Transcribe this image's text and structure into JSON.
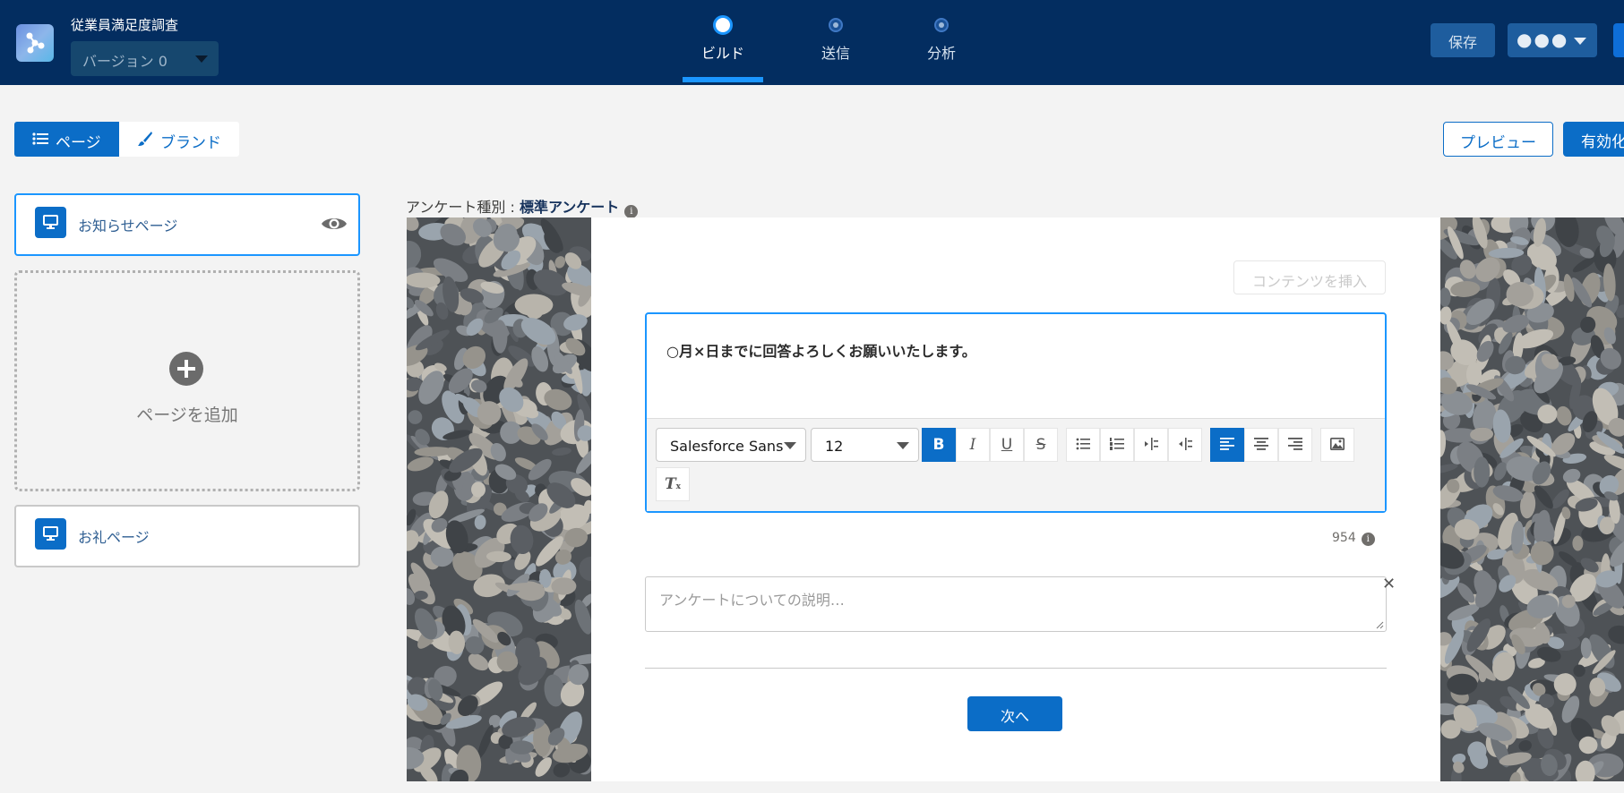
{
  "header": {
    "survey_title": "従業員満足度調査",
    "version_label": "バージョン 0",
    "steps": [
      {
        "label": "ビルド",
        "active": true
      },
      {
        "label": "送信",
        "active": false
      },
      {
        "label": "分析",
        "active": false
      }
    ],
    "save_label": "保存",
    "more_label": "●●●"
  },
  "toolbar": {
    "pages_tab": "ページ",
    "brand_tab": "ブランド",
    "preview_label": "プレビュー",
    "activate_label": "有効化"
  },
  "sidebar": {
    "pages": [
      {
        "name": "お知らせページ"
      },
      {
        "name": "お礼ページ"
      }
    ],
    "add_page_label": "ページを追加"
  },
  "canvas": {
    "survey_type_label": "アンケート種別 : ",
    "survey_type_value": "標準アンケート",
    "insert_content_label": "コンテンツを挿入",
    "welcome_text": "○月×日までに回答よろしくお願いいたします。",
    "font_family": "Salesforce Sans",
    "font_size": "12",
    "char_count": "954",
    "description_placeholder": "アンケートについての説明…",
    "next_button": "次へ"
  },
  "colors": {
    "header_bg": "#032d60",
    "brand_blue": "#0b6dc7",
    "focus_blue": "#1b96ff"
  }
}
